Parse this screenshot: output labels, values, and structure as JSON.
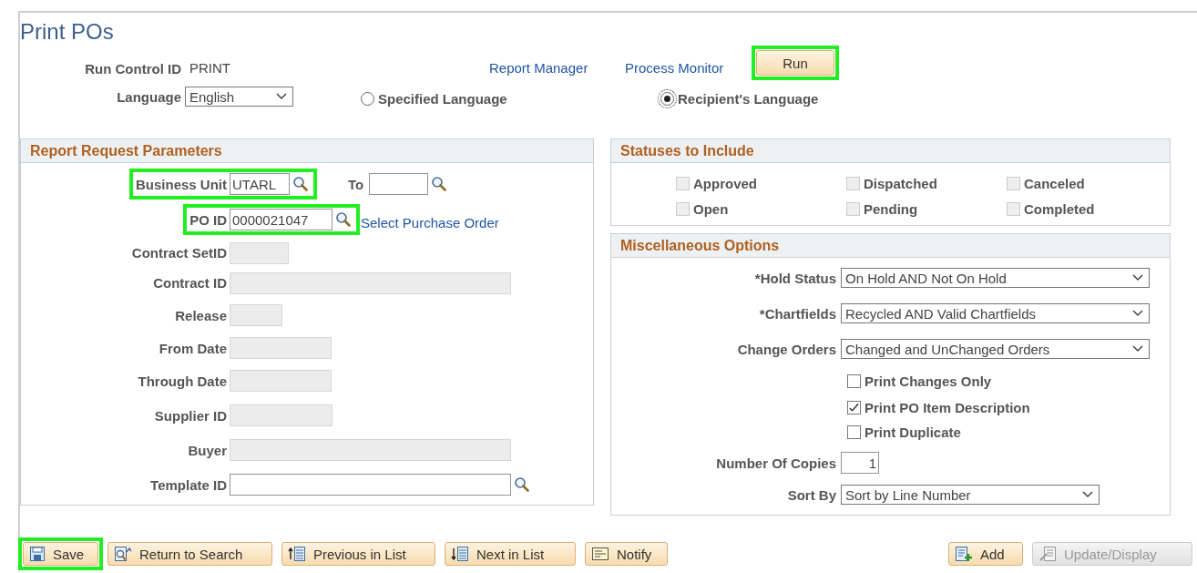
{
  "page": {
    "title": "Print POs"
  },
  "header": {
    "run_control_label": "Run Control ID",
    "run_control_value": "PRINT",
    "links": [
      "Report Manager",
      "Process Monitor"
    ],
    "run_button": {
      "label": "Run",
      "highlighted": true
    },
    "language": {
      "label": "Language",
      "value": "English"
    },
    "language_options": [
      {
        "label": "Specified Language",
        "selected": false
      },
      {
        "label": "Recipient's Language",
        "selected": true
      }
    ]
  },
  "report_parameters": {
    "title": "Report Request Parameters",
    "fields": [
      {
        "label": "Business Unit",
        "value": "UTARL",
        "kind": "lookup",
        "disabled": false,
        "highlighted": true,
        "to": {
          "label": "To"
        }
      },
      {
        "label": "PO ID",
        "value": "0000021047",
        "kind": "lookup",
        "disabled": false,
        "highlighted": true,
        "link": "Select Purchase Order"
      },
      {
        "label": "Contract SetID",
        "kind": "text",
        "disabled": true,
        "highlighted": false
      },
      {
        "label": "Contract ID",
        "kind": "text",
        "disabled": true,
        "highlighted": false
      },
      {
        "label": "Release",
        "kind": "text",
        "disabled": true,
        "highlighted": false
      },
      {
        "label": "From Date",
        "kind": "text",
        "disabled": true,
        "highlighted": false
      },
      {
        "label": "Through Date",
        "kind": "text",
        "disabled": true,
        "highlighted": false
      },
      {
        "label": "Supplier ID",
        "kind": "text",
        "disabled": true,
        "highlighted": false
      },
      {
        "label": "Buyer",
        "kind": "text",
        "disabled": true,
        "highlighted": false
      },
      {
        "label": "Template ID",
        "kind": "lookup",
        "disabled": false,
        "highlighted": false
      }
    ]
  },
  "statuses": {
    "title": "Statuses to Include",
    "items": [
      {
        "label": "Approved",
        "checked": false,
        "disabled": true
      },
      {
        "label": "Dispatched",
        "checked": false,
        "disabled": true
      },
      {
        "label": "Canceled",
        "checked": false,
        "disabled": true
      },
      {
        "label": "Open",
        "checked": false,
        "disabled": true
      },
      {
        "label": "Pending",
        "checked": false,
        "disabled": true
      },
      {
        "label": "Completed",
        "checked": false,
        "disabled": true
      }
    ]
  },
  "misc": {
    "title": "Miscellaneous Options",
    "rows": [
      {
        "kind": "select",
        "label": "*Hold Status",
        "value": "On Hold AND Not On Hold"
      },
      {
        "kind": "select",
        "label": "*Chartfields",
        "value": "Recycled AND Valid Chartfields"
      },
      {
        "kind": "select",
        "label": "Change Orders",
        "value": "Changed and UnChanged Orders"
      },
      {
        "kind": "checkbox",
        "label": "Print Changes Only",
        "checked": false
      },
      {
        "kind": "checkbox",
        "label": "Print PO Item Description",
        "checked": true
      },
      {
        "kind": "checkbox",
        "label": "Print Duplicate",
        "checked": false
      },
      {
        "kind": "number",
        "label": "Number Of Copies",
        "value": "1"
      },
      {
        "kind": "select",
        "label": "Sort By",
        "value": "Sort by Line Number"
      }
    ]
  },
  "toolbar": {
    "left": [
      {
        "label": "Save",
        "kind": "save",
        "highlighted": true,
        "disabled": false
      },
      {
        "label": "Return to Search",
        "kind": "return",
        "highlighted": false,
        "disabled": false
      },
      {
        "label": "Previous in List",
        "kind": "previous",
        "highlighted": false,
        "disabled": false
      },
      {
        "label": "Next in List",
        "kind": "next",
        "highlighted": false,
        "disabled": false
      },
      {
        "label": "Notify",
        "kind": "notify",
        "highlighted": false,
        "disabled": false
      }
    ],
    "right": [
      {
        "label": "Add",
        "kind": "add",
        "highlighted": false,
        "disabled": false
      },
      {
        "label": "Update/Display",
        "kind": "update",
        "highlighted": false,
        "disabled": true
      }
    ]
  }
}
